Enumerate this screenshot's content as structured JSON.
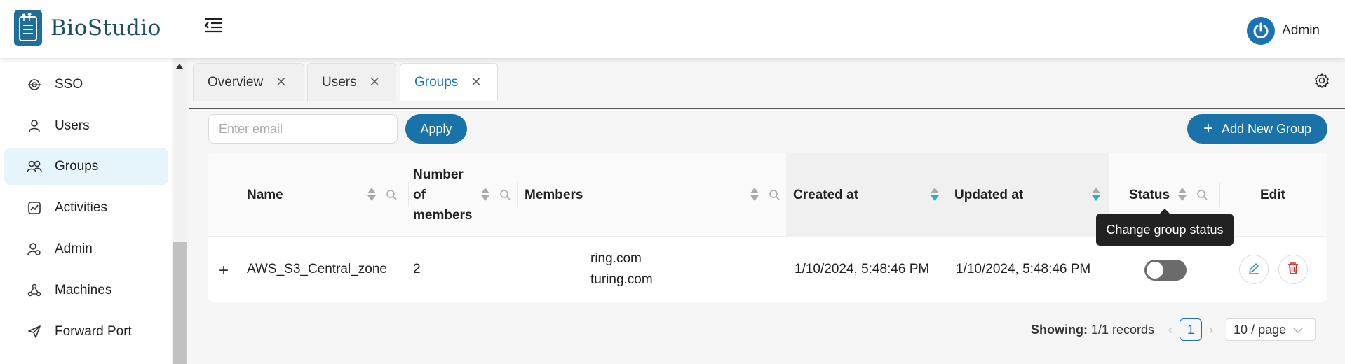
{
  "brand": {
    "name": "BioStudio",
    "accent": "#1a73a8"
  },
  "user": {
    "name": "Admin"
  },
  "sidebar": {
    "items": [
      {
        "label": "SSO",
        "icon": "sso-icon"
      },
      {
        "label": "Users",
        "icon": "user-icon"
      },
      {
        "label": "Groups",
        "icon": "groups-icon",
        "active": true
      },
      {
        "label": "Activities",
        "icon": "activities-icon"
      },
      {
        "label": "Admin",
        "icon": "admin-icon"
      },
      {
        "label": "Machines",
        "icon": "machines-icon"
      },
      {
        "label": "Forward Port",
        "icon": "send-icon"
      }
    ]
  },
  "tabs": [
    {
      "label": "Overview"
    },
    {
      "label": "Users"
    },
    {
      "label": "Groups",
      "active": true
    }
  ],
  "toolbar": {
    "email_placeholder": "Enter email",
    "apply_label": "Apply",
    "add_label": "Add New Group"
  },
  "table": {
    "columns": {
      "name": "Name",
      "members_count_l1": "Number",
      "members_count_l2": "of",
      "members_count_l3": "members",
      "members": "Members",
      "created": "Created at",
      "updated": "Updated at",
      "status": "Status",
      "edit": "Edit"
    },
    "rows": [
      {
        "name": "AWS_S3_Central_zone",
        "count": "2",
        "members_1": "ring.com",
        "members_2": "turing.com",
        "created": "1/10/2024, 5:48:46 PM",
        "updated": "1/10/2024, 5:48:46 PM",
        "status_on": false
      }
    ]
  },
  "tooltip": "Change group status",
  "pagination": {
    "showing_label": "Showing:",
    "showing_value": "1/1 records",
    "current_page": "1",
    "page_size": "10 / page"
  }
}
